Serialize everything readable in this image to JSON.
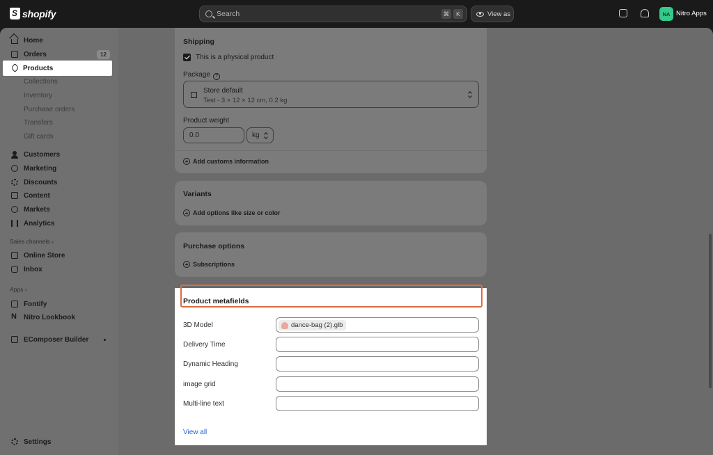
{
  "topbar": {
    "logo_text": "shopify",
    "search_placeholder": "Search",
    "shortcut_keys": [
      "⌘",
      "K"
    ],
    "view_as_label": "View as",
    "avatar_initials": "NA",
    "store_name": "Nitro Apps"
  },
  "sidebar": {
    "main_items": [
      {
        "label": "Home",
        "icon": "home-icon"
      },
      {
        "label": "Orders",
        "icon": "inbox-icon",
        "badge": "12"
      },
      {
        "label": "Products",
        "icon": "tag-icon",
        "active": true
      }
    ],
    "product_subitems": [
      "Collections",
      "Inventory",
      "Purchase orders",
      "Transfers",
      "Gift cards"
    ],
    "more_items": [
      {
        "label": "Customers",
        "icon": "person-icon"
      },
      {
        "label": "Marketing",
        "icon": "target-icon"
      },
      {
        "label": "Discounts",
        "icon": "discount-icon"
      },
      {
        "label": "Content",
        "icon": "content-icon"
      },
      {
        "label": "Markets",
        "icon": "globe-icon"
      },
      {
        "label": "Analytics",
        "icon": "bar-chart-icon"
      }
    ],
    "sales_channels_label": "Sales channels ›",
    "sales_channels": [
      {
        "label": "Online Store",
        "icon": "store-icon"
      },
      {
        "label": "Inbox",
        "icon": "chat-icon"
      }
    ],
    "apps_label": "Apps ›",
    "apps": [
      {
        "label": "Fontify",
        "icon": "app-icon"
      },
      {
        "label": "Nitro Lookbook",
        "icon": "n-icon"
      },
      {
        "label": "EComposer Builder",
        "icon": "ecomposer-icon"
      }
    ],
    "settings_label": "Settings"
  },
  "shipping": {
    "title": "Shipping",
    "physical_label": "This is a physical product",
    "physical_checked": true,
    "package_label": "Package",
    "package_name": "Store default",
    "package_detail": "Test - 3 × 12 × 12 cm, 0.2 kg",
    "weight_label": "Product weight",
    "weight_value": "0.0",
    "weight_unit": "kg",
    "customs_link": "Add customs information"
  },
  "variants": {
    "title": "Variants",
    "add_link": "Add options like size or color"
  },
  "purchase_options": {
    "title": "Purchase options",
    "link": "Subscriptions"
  },
  "metafields": {
    "title": "Product metafields",
    "fields": [
      {
        "label": "3D Model",
        "value": "dance-bag (2).glb"
      },
      {
        "label": "Delivery Time",
        "value": ""
      },
      {
        "label": "Dynamic Heading",
        "value": ""
      },
      {
        "label": "image grid",
        "value": ""
      },
      {
        "label": "Multi-line text",
        "value": ""
      }
    ],
    "view_all": "View all"
  },
  "colors": {
    "highlight": "#e06a3e",
    "link": "#2463d1",
    "avatar": "#35c98a"
  }
}
